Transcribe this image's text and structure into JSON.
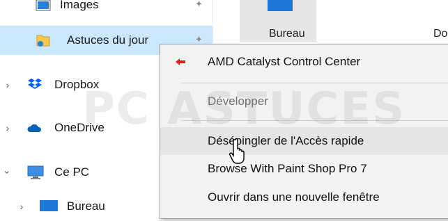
{
  "nav": {
    "items": [
      {
        "label": "Images",
        "icon": "images-folder-icon"
      },
      {
        "label": "Astuces du jour",
        "icon": "user-folder-icon"
      },
      {
        "label": "Dropbox",
        "icon": "dropbox-icon"
      },
      {
        "label": "OneDrive",
        "icon": "onedrive-cloud-icon"
      },
      {
        "label": "Ce PC",
        "icon": "computer-monitor-icon"
      },
      {
        "label": "Bureau",
        "icon": "desktop-folder-icon"
      }
    ]
  },
  "content": {
    "tiles": [
      {
        "caption": "Bureau"
      },
      {
        "caption": "Do"
      }
    ]
  },
  "context_menu": {
    "items": [
      {
        "label": "AMD Catalyst Control Center",
        "icon": "amd-catalyst-icon",
        "state": "enabled"
      },
      {
        "label": "Développer",
        "state": "disabled"
      },
      {
        "label": "Désépingler de l'Accès rapide",
        "state": "hover"
      },
      {
        "label": "Browse With Paint Shop Pro 7",
        "state": "enabled"
      },
      {
        "label": "Ouvrir dans une nouvelle fenêtre",
        "state": "enabled"
      }
    ]
  },
  "watermark": {
    "logo_text": "PC ASTUCES"
  },
  "colors": {
    "selection": "#cce8ff",
    "menu_bg": "#f2f2f2",
    "menu_hover": "#e5e5e5",
    "dropbox_blue": "#0061fe",
    "onedrive_blue": "#0364b8",
    "amd_red": "#e02020"
  }
}
